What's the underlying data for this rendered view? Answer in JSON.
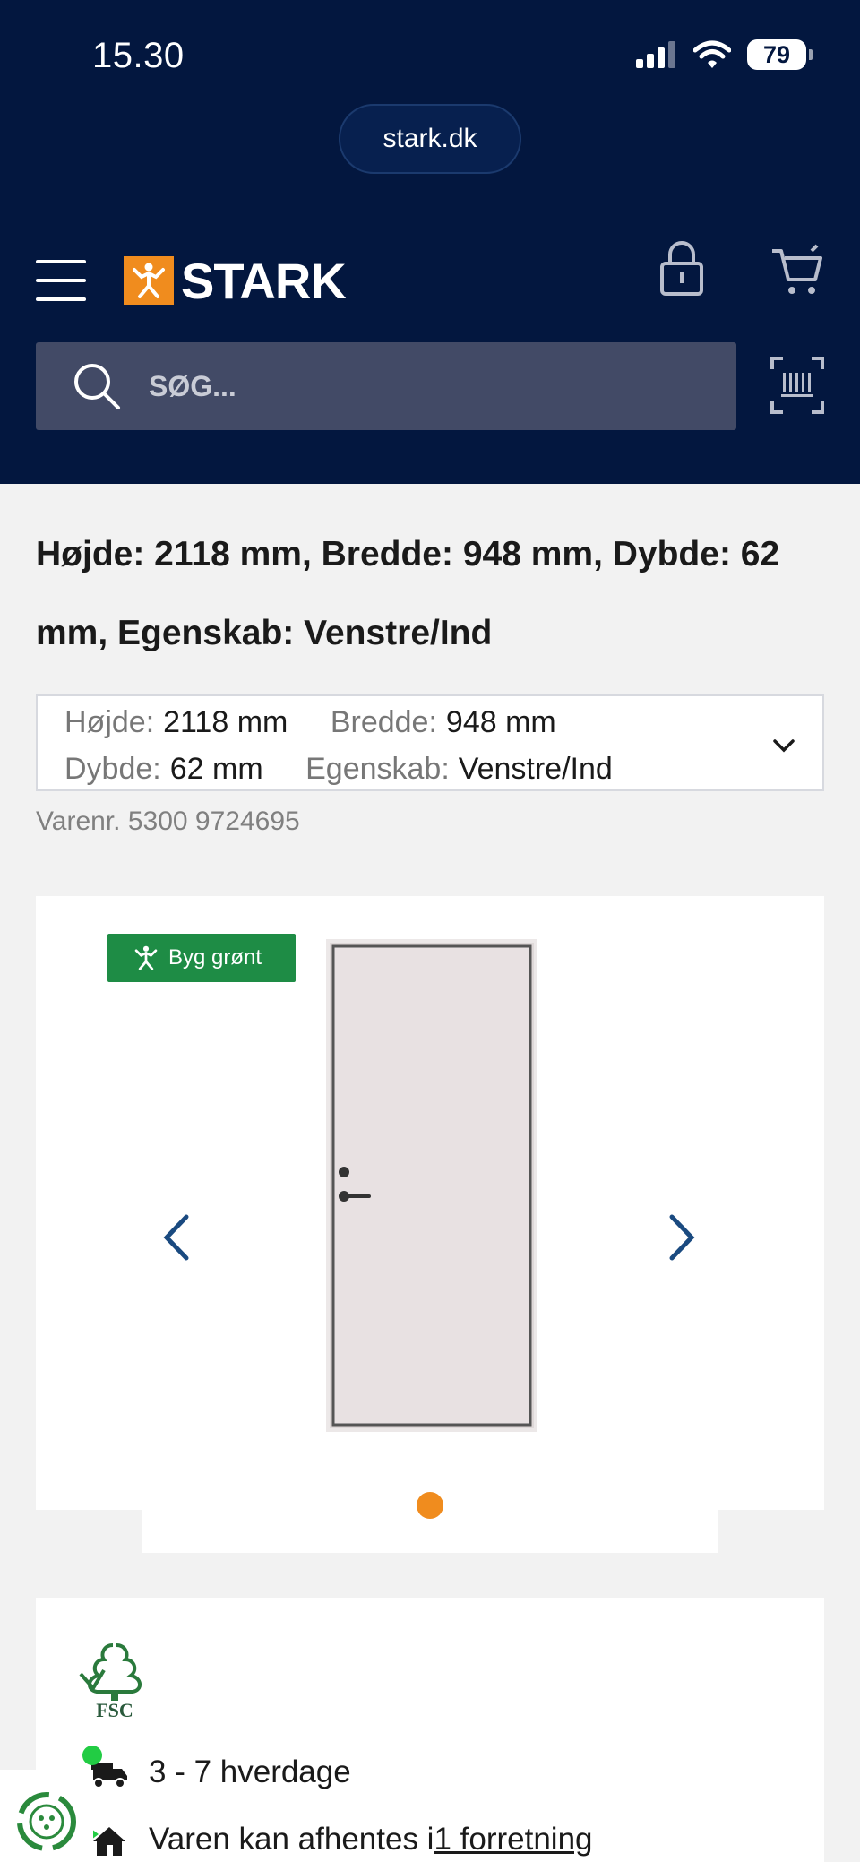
{
  "status_bar": {
    "time": "15.30",
    "battery": "79"
  },
  "browser": {
    "url": "stark.dk"
  },
  "header": {
    "logo_text": "STARK",
    "search_placeholder": "SØG..."
  },
  "product": {
    "title": "Højde: 2118 mm, Bredde: 948 mm, Dybde: 62 mm, Egenskab: Venstre/Ind",
    "variant": {
      "hojde_label": "Højde:",
      "hojde_value": "2118 mm",
      "bredde_label": "Bredde:",
      "bredde_value": "948 mm",
      "dybde_label": "Dybde:",
      "dybde_value": "62 mm",
      "egenskab_label": "Egenskab:",
      "egenskab_value": "Venstre/Ind"
    },
    "varenr": "Varenr. 5300 9724695",
    "badge": "Byg grønt"
  },
  "info": {
    "fsc_label": "FSC",
    "delivery": "3 - 7 hverdage",
    "pickup_text": "Varen kan afhentes i ",
    "pickup_link": "1 forretning"
  },
  "colors": {
    "navy": "#03173f",
    "orange": "#f08c1e",
    "green": "#1e8c45"
  }
}
